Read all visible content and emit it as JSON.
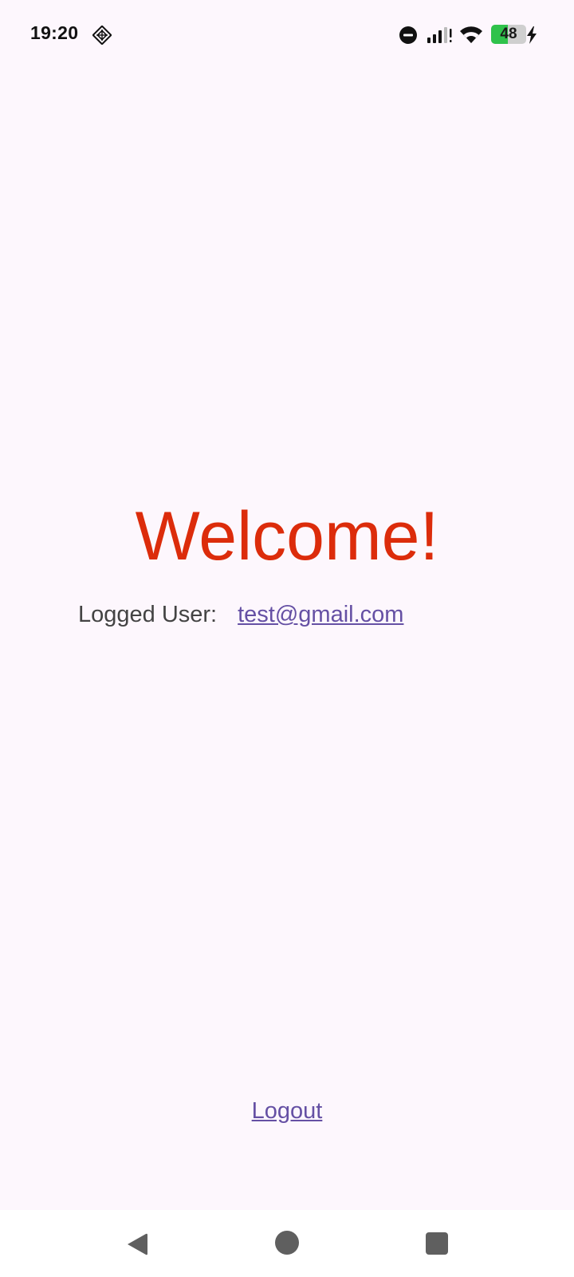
{
  "status_bar": {
    "time": "19:20",
    "battery_percent": 48,
    "battery_label": "48",
    "icons": [
      "app-notification-icon",
      "do-not-disturb-icon",
      "signal-icon",
      "wifi-icon",
      "battery-icon",
      "charging-icon"
    ]
  },
  "main": {
    "title": "Welcome!",
    "logged_label": "Logged User:",
    "logged_email": "test@gmail.com",
    "logout_label": "Logout"
  },
  "colors": {
    "background": "#fdf7fd",
    "title": "#dc2c0b",
    "link": "#6550a4",
    "label": "#434343"
  },
  "nav_bar": {
    "icons": [
      "back-icon",
      "home-icon",
      "recents-icon"
    ]
  }
}
